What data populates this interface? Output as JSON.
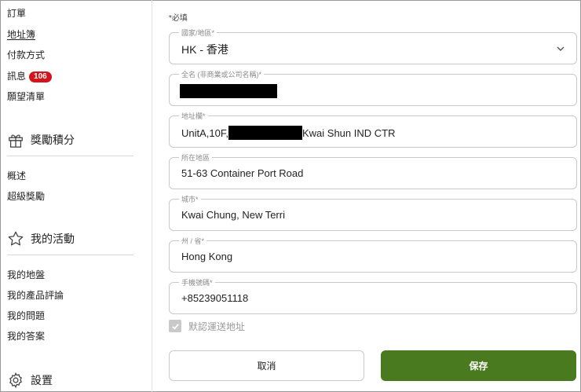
{
  "sidebar": {
    "account_links": [
      {
        "label": "訂單"
      },
      {
        "label": "地址簿",
        "active": true
      },
      {
        "label": "付款方式"
      },
      {
        "label": "訊息",
        "badge": "106"
      },
      {
        "label": "願望清單"
      }
    ],
    "rewards": {
      "heading": "獎勵積分",
      "icon": "gift-icon",
      "links": [
        {
          "label": "概述"
        },
        {
          "label": "超級獎勵"
        }
      ]
    },
    "activity": {
      "heading": "我的活動",
      "icon": "star-icon",
      "links": [
        {
          "label": "我的地盤"
        },
        {
          "label": "我的產品評論"
        },
        {
          "label": "我的問題"
        },
        {
          "label": "我的答案"
        }
      ]
    },
    "settings": {
      "heading": "設置",
      "icon": "gear-icon"
    }
  },
  "form": {
    "required_note": "*必填",
    "country": {
      "label": "國家/地區*",
      "value": "HK - 香港"
    },
    "full_name": {
      "label": "全名 (非商業或公司名稱)*",
      "value": ""
    },
    "address": {
      "label": "地址欄*",
      "value_prefix": "UnitA,10F,",
      "value_suffix": "Kwai Shun IND CTR"
    },
    "district": {
      "label": "所在地區",
      "value": "51-63 Container Port Road"
    },
    "city": {
      "label": "城市*",
      "value": "Kwai Chung, New Terri"
    },
    "state": {
      "label": "州 / 省*",
      "value": "Hong Kong"
    },
    "phone": {
      "label": "手機號碼*",
      "value": "+85239051118"
    },
    "default_address": {
      "label": "默認運送地址",
      "checked": true
    },
    "cancel_label": "取消",
    "save_label": "保存"
  },
  "colors": {
    "save_button": "#4a7a1f",
    "badge": "#d3141c",
    "field_border": "#c9c9c9"
  }
}
